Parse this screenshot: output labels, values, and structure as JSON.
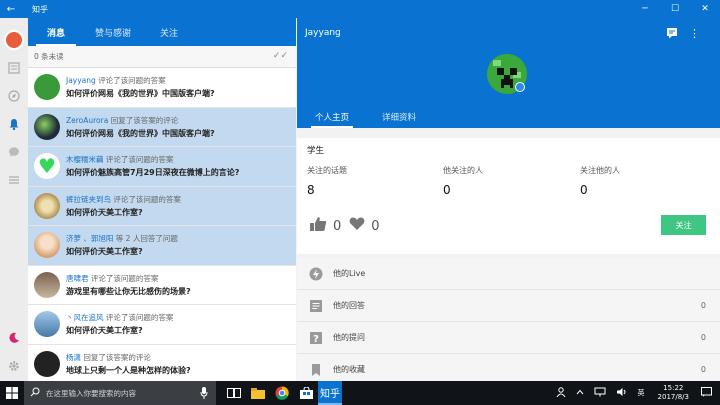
{
  "window": {
    "title": "知乎",
    "back_glyph": "←",
    "min_glyph": "─",
    "max_glyph": "☐",
    "close_glyph": "✕"
  },
  "tabs": [
    {
      "label": "消息",
      "active": true
    },
    {
      "label": "赞与感谢",
      "active": false
    },
    {
      "label": "关注",
      "active": false
    }
  ],
  "unread": "0 条未读",
  "notifications": [
    {
      "name": "Jayyang",
      "action": "评论了该问题的答案",
      "question": "如何评价网易《我的世界》中国版客户端?",
      "color": "#3a9a3a",
      "selected": false
    },
    {
      "name": "ZeroAurora",
      "action": "回复了该答案的评论",
      "question": "如何评价网易《我的世界》中国版客户端?",
      "color": "#1d2b3a",
      "selected": true
    },
    {
      "name": "木樱糯米藕",
      "action": "评论了该问题的答案",
      "question": "如何评价魅族高管7月29日深夜在微博上的言论?",
      "color": "#37d85a",
      "selected": true
    },
    {
      "name": "裤拉链夹到鸟",
      "action": "评论了该问题的答案",
      "question": "如何评价天美工作室?",
      "color": "#c9b07a",
      "selected": true
    },
    {
      "name": "济萝 、郭旭阳",
      "action": "等 2 人回答了问题",
      "question": "如何评价天美工作室?",
      "color": "#d8a070",
      "selected": true
    },
    {
      "name": "唐啸君",
      "action": "评论了该问题的答案",
      "question": "游戏里有哪些让你无比感伤的场景?",
      "color": "#8a7060",
      "selected": false
    },
    {
      "name": "丶风在追风",
      "action": "评论了该问题的答案",
      "question": "如何评价天美工作室?",
      "color": "#6fa0c8",
      "selected": false
    },
    {
      "name": "杨潇",
      "action": "回复了该答案的评论",
      "question": "地球上只剩一个人是种怎样的体验?",
      "color": "#222222",
      "selected": false
    }
  ],
  "profile": {
    "username": "Jayyang",
    "tabs": [
      "个人主页",
      "详细资料"
    ],
    "role": "学生",
    "stats": [
      {
        "label": "关注的话题",
        "value": "8"
      },
      {
        "label": "他关注的人",
        "value": "0"
      },
      {
        "label": "关注他的人",
        "value": "0"
      }
    ],
    "likes": "0",
    "thanks": "0",
    "follow_label": "关注",
    "menu": [
      {
        "label": "他的Live",
        "count": "",
        "icon": "lightning-icon"
      },
      {
        "label": "他的回答",
        "count": "0",
        "icon": "answer-icon"
      },
      {
        "label": "他的提问",
        "count": "0",
        "icon": "question-icon"
      },
      {
        "label": "他的收藏",
        "count": "0",
        "icon": "bookmark-icon"
      }
    ]
  },
  "taskbar": {
    "search_placeholder": "在这里输入你要搜索的内容",
    "ime": "英",
    "time": "15:22",
    "date": "2017/8/3"
  },
  "colors": {
    "brand": "#0a73d2",
    "follow": "#3ec682",
    "name_link": "#1a73c4"
  }
}
